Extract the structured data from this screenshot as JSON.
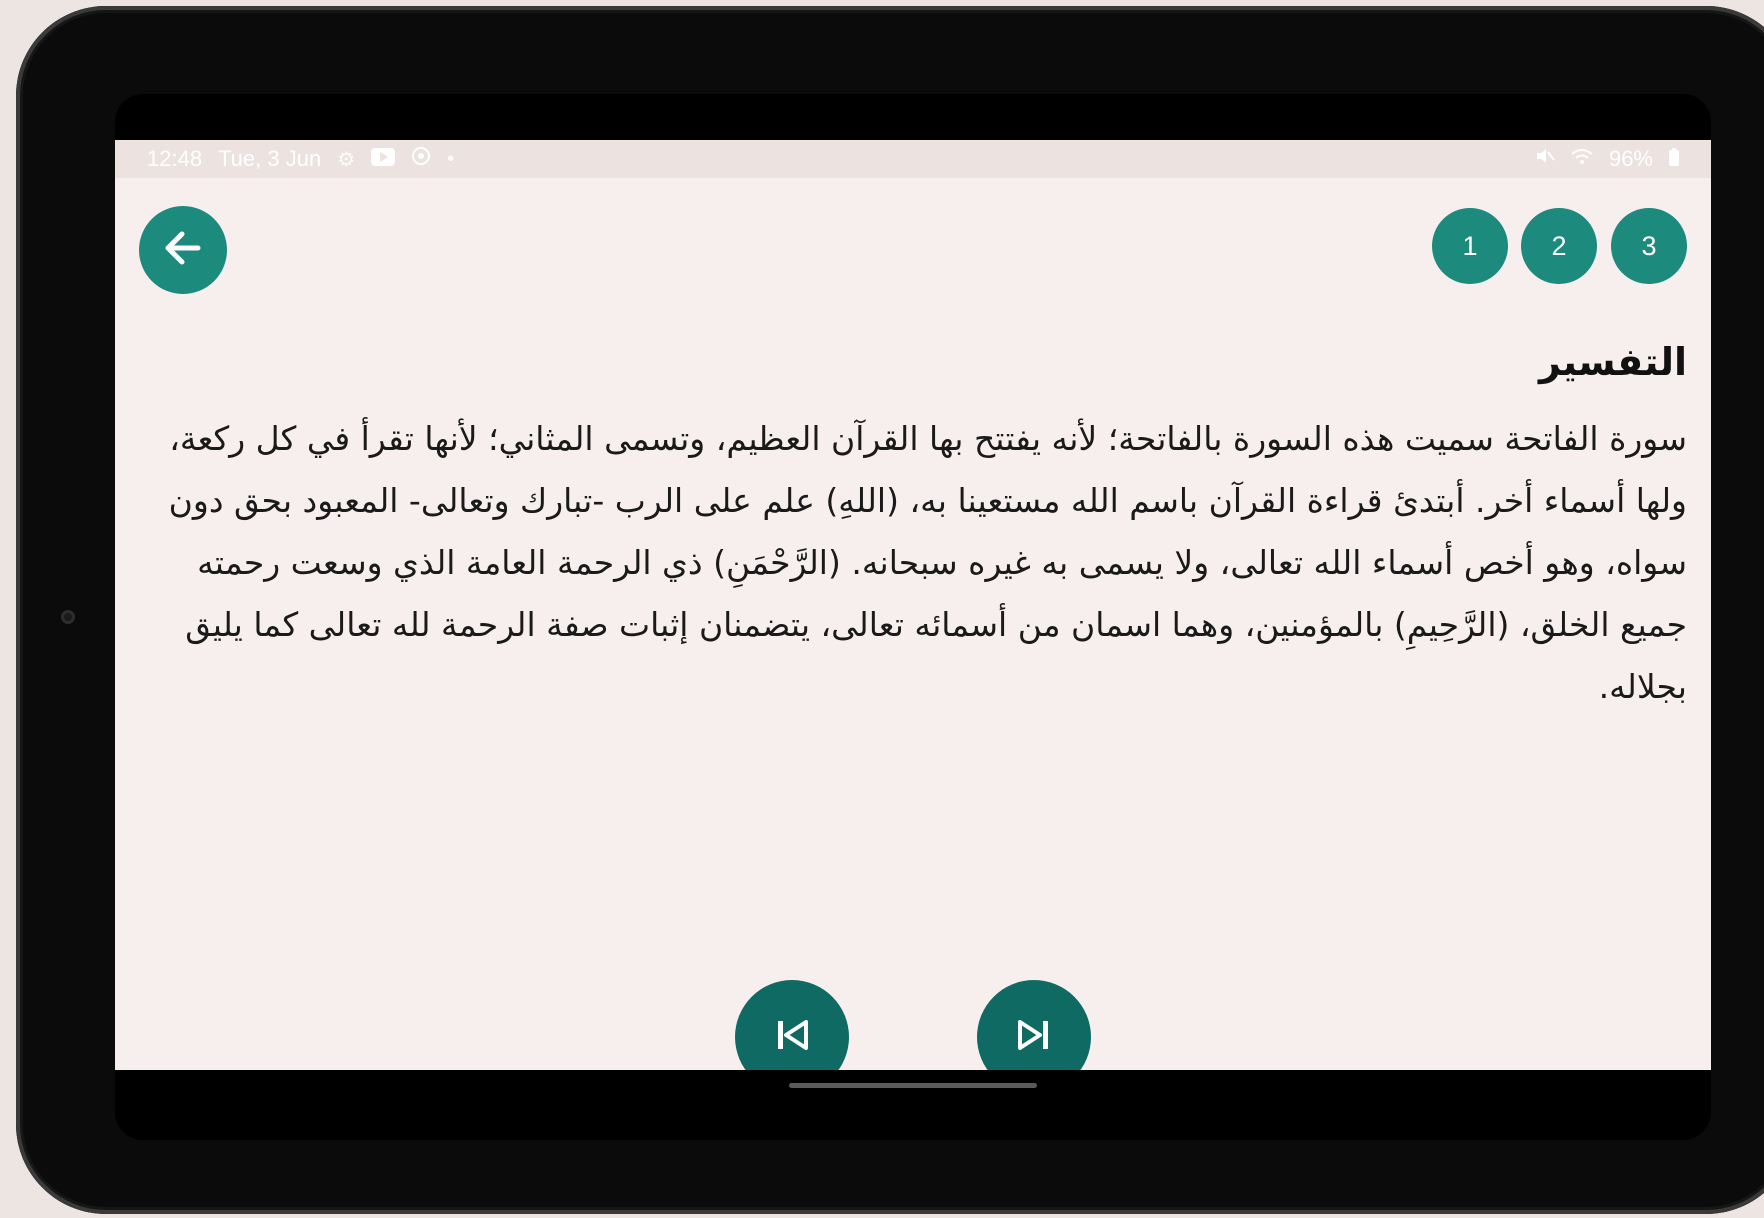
{
  "status_bar": {
    "time": "12:48",
    "date": "Tue, 3 Jun",
    "battery": "96%",
    "left_icons": [
      "settings-icon",
      "youtube-icon",
      "target-icon",
      "dot-icon"
    ],
    "right_icons": [
      "mute-icon",
      "wifi-icon",
      "battery-icon"
    ]
  },
  "header": {
    "back_icon": "arrow-left-icon",
    "pages": [
      {
        "label": "3"
      },
      {
        "label": "2"
      },
      {
        "label": "1"
      }
    ]
  },
  "content": {
    "heading": "التفسير",
    "body": "سورة الفاتحة سميت هذه السورة بالفاتحة؛ لأنه يفتتح بها القرآن العظيم، وتسمى المثاني؛ لأنها تقرأ في كل ركعة، ولها أسماء أخر. أبتدئ قراءة القرآن باسم الله مستعينا به، (اللهِ) علم على الرب -تبارك وتعالى- المعبود بحق دون سواه، وهو أخص أسماء الله تعالى، ولا يسمى به غيره سبحانه. (الرَّحْمَنِ) ذي الرحمة العامة الذي وسعت رحمته جميع الخلق، (الرَّحِيمِ) بالمؤمنين، وهما اسمان من أسمائه تعالى، يتضمنان إثبات صفة الرحمة لله تعالى كما يليق بجلاله."
  },
  "controls": {
    "prev_icon": "skip-previous-icon",
    "next_icon": "skip-next-icon"
  },
  "colors": {
    "accent": "#1c8a7c",
    "accent_dark": "#0f6a63",
    "background": "#f7efed"
  }
}
